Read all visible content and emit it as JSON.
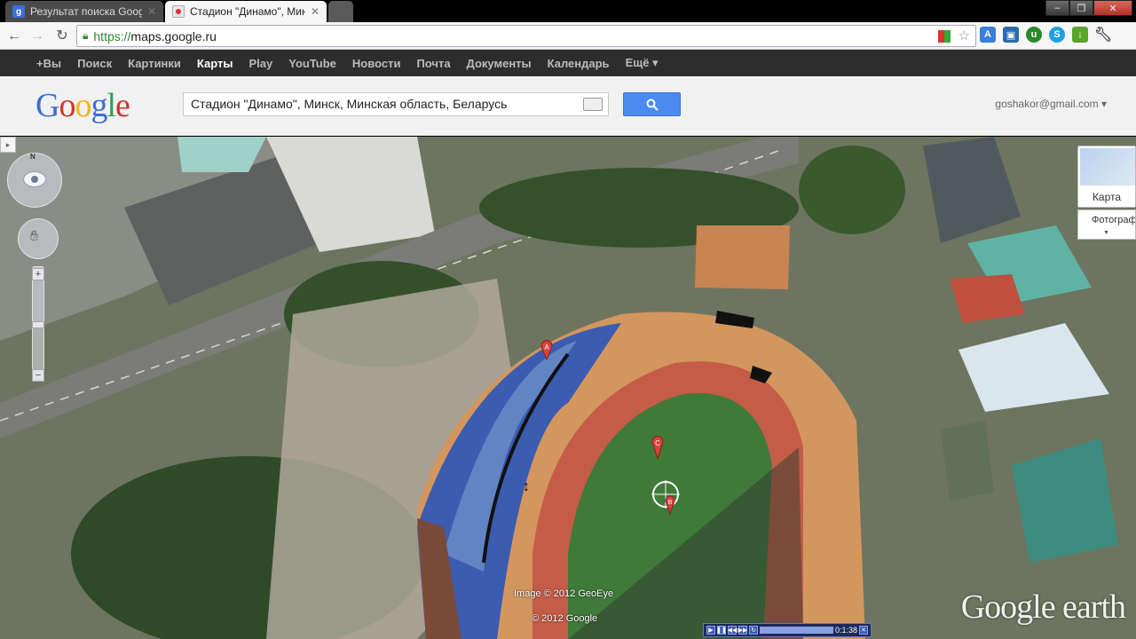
{
  "browser": {
    "tabs": [
      {
        "title": "Результат поиска Google",
        "favicon": "google-g-icon"
      },
      {
        "title": "Стадион \"Динамо\", Минск",
        "favicon": "google-maps-icon"
      }
    ],
    "url_scheme": "https://",
    "url_host": "maps.google.ru"
  },
  "gbar": {
    "items": [
      "+Вы",
      "Поиск",
      "Картинки",
      "Карты",
      "Play",
      "YouTube",
      "Новости",
      "Почта",
      "Документы",
      "Календарь",
      "Ещё ▾"
    ],
    "active_index": 3
  },
  "header": {
    "logo_letters": [
      "G",
      "o",
      "o",
      "g",
      "l",
      "e"
    ],
    "search_value": "Стадион \"Динамо\", Минск, Минская область, Беларусь",
    "account": "goshakor@gmail.com ▾"
  },
  "map": {
    "map_type_label": "Карта",
    "photos_label": "Фотографии",
    "imagery_credit": "Image © 2012 GeoEye",
    "google_credit": "© 2012 Google",
    "earth_logo": "Google earth",
    "player_time": "0:1:38",
    "markers": [
      {
        "letter": "A",
        "color": "#d9413a"
      },
      {
        "letter": "C",
        "color": "#d9413a"
      },
      {
        "letter": "B",
        "color": "#d9413a"
      }
    ]
  },
  "colors": {
    "accent_blue": "#4a8bf0",
    "gbar_bg": "#2d2d2d",
    "marker_red": "#d9413a"
  }
}
